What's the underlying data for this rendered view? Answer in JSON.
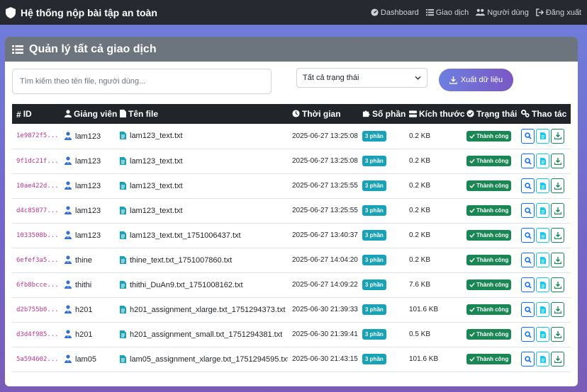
{
  "navbar": {
    "brand": "Hệ thống nộp bài tập an toàn",
    "links": [
      {
        "label": "Dashboard",
        "icon": "dashboard-icon"
      },
      {
        "label": "Giao dịch",
        "icon": "list-icon"
      },
      {
        "label": "Người dùng",
        "icon": "users-icon"
      },
      {
        "label": "Đăng xuất",
        "icon": "logout-icon"
      }
    ]
  },
  "card": {
    "title": "Quản lý tất cả giao dịch"
  },
  "toolbar": {
    "search_placeholder": "Tìm kiếm theo tên file, người dùng...",
    "status_filter": "Tất cả trạng thái",
    "export_label": "Xuất dữ liệu"
  },
  "table": {
    "headers": {
      "id": "ID",
      "teacher": "Giảng viên",
      "filename": "Tên file",
      "time": "Thời gian",
      "parts": "Số phần",
      "size": "Kích thước",
      "status": "Trạng thái",
      "actions": "Thao tác"
    },
    "rows": [
      {
        "id": "1e9872f5...",
        "user": "lam123",
        "file": "lam123_text.txt",
        "time": "2025-06-27 13:25:08",
        "parts": "3 phần",
        "size": "0.2 KB",
        "status": "Thành công"
      },
      {
        "id": "9f1dc21f...",
        "user": "lam123",
        "file": "lam123_text.txt",
        "time": "2025-06-27 13:25:08",
        "parts": "3 phần",
        "size": "0.2 KB",
        "status": "Thành công"
      },
      {
        "id": "10ae422d...",
        "user": "lam123",
        "file": "lam123_text.txt",
        "time": "2025-06-27 13:25:55",
        "parts": "3 phần",
        "size": "0.2 KB",
        "status": "Thành công"
      },
      {
        "id": "d4c85877...",
        "user": "lam123",
        "file": "lam123_text.txt",
        "time": "2025-06-27 13:25:55",
        "parts": "3 phần",
        "size": "0.2 KB",
        "status": "Thành công"
      },
      {
        "id": "1033508b...",
        "user": "lam123",
        "file": "lam123_text.txt_1751006437.txt",
        "time": "2025-06-27 13:40:37",
        "parts": "3 phần",
        "size": "0.2 KB",
        "status": "Thành công"
      },
      {
        "id": "6efef3a5...",
        "user": "thine",
        "file": "thine_text.txt_1751007860.txt",
        "time": "2025-06-27 14:04:20",
        "parts": "3 phần",
        "size": "0.2 KB",
        "status": "Thành công"
      },
      {
        "id": "6fb8bcce...",
        "user": "thithi",
        "file": "thithi_DuAn9.txt_1751008162.txt",
        "time": "2025-06-27 14:09:22",
        "parts": "3 phần",
        "size": "7.6 KB",
        "status": "Thành công"
      },
      {
        "id": "d2b755b0...",
        "user": "h201",
        "file": "h201_assignment_xlarge.txt_1751294373.txt",
        "time": "2025-06-30 21:39:33",
        "parts": "3 phần",
        "size": "101.6 KB",
        "status": "Thành công"
      },
      {
        "id": "d3d4f985...",
        "user": "h201",
        "file": "h201_assignment_small.txt_1751294381.txt",
        "time": "2025-06-30 21:39:41",
        "parts": "3 phần",
        "size": "0.5 KB",
        "status": "Thành công"
      },
      {
        "id": "5a594602...",
        "user": "lam05",
        "file": "lam05_assignment_xlarge.txt_1751294595.txt",
        "time": "2025-06-30 21:43:15",
        "parts": "3 phần",
        "size": "101.6 KB",
        "status": "Thành công"
      }
    ]
  },
  "colors": {
    "navbar": "#262a30",
    "card_header": "#6c757d",
    "table_header": "#212529",
    "id_text": "#c2338a",
    "parts_badge": "#17a2b8",
    "status_badge": "#198754",
    "export_gradient_start": "#6d7fe0",
    "export_gradient_end": "#7b57c4"
  }
}
